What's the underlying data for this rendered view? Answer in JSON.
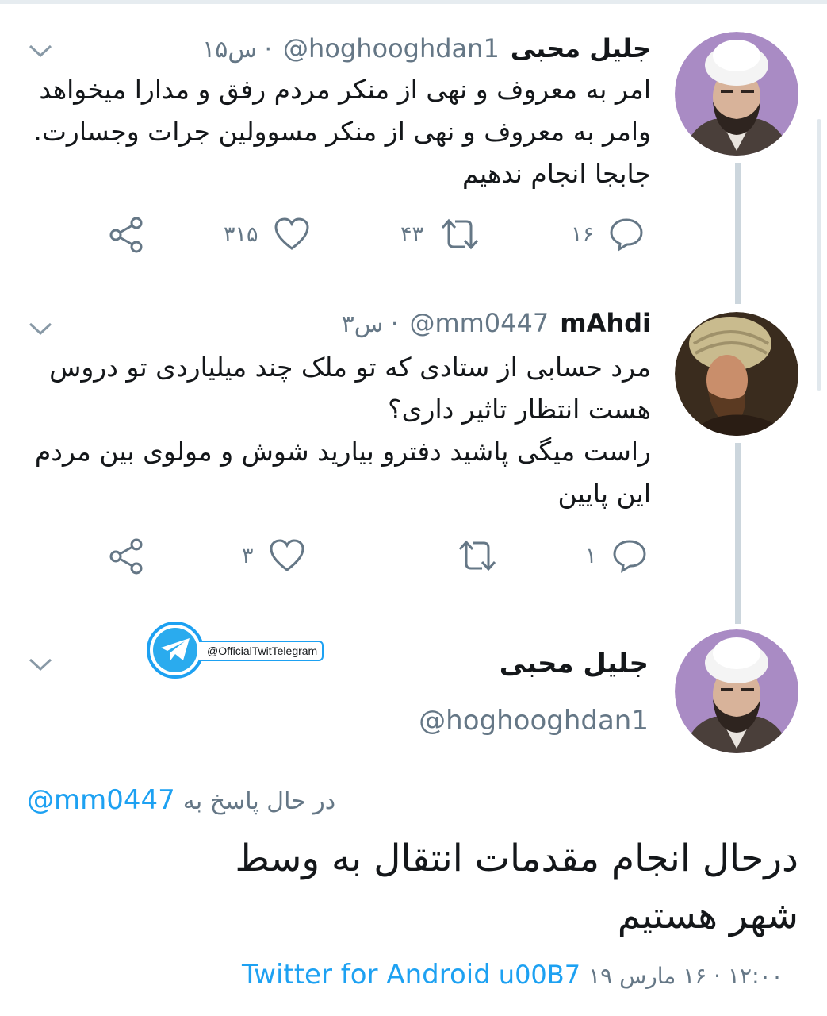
{
  "colors": {
    "accent": "#1da1f2",
    "muted": "#657786",
    "text": "#14171a",
    "thread_line": "#ccd6dd"
  },
  "tweets": [
    {
      "name": "جلیل محبی",
      "handle": "@hoghooghdan1",
      "time": "۱۵س · ",
      "lines": [
        "امر به معروف و نهی از منکر مردم رفق و مدارا میخواهد",
        "وامر به معروف و نهی از منکر مسوولین جرات وجسارت.",
        "جابجا انجام ندهیم"
      ],
      "actions": {
        "reply_count": "۱۶",
        "retweet_count": "۴۳",
        "like_count": "۳۱۵",
        "share_count": ""
      }
    },
    {
      "name": "mAhdi",
      "handle": "@mm0447",
      "time": "۳س · ",
      "lines": [
        "مرد حسابی از ستادی که تو ملک چند میلیاردی تو دروس",
        "هست انتظار تاثیر داری؟",
        "راست میگی پاشید دفترو بیارید شوش و مولوی بین مردم",
        "این پایین"
      ],
      "actions": {
        "reply_count": "۱",
        "retweet_count": "",
        "like_count": "۳",
        "share_count": ""
      }
    }
  ],
  "main_tweet": {
    "name": "جلیل محبی",
    "handle": "@hoghooghdan1",
    "reply_prefix": "در حال پاسخ به",
    "reply_to": "@mm0447",
    "lines": [
      "درحال انجام مقدمات انتقال به وسط",
      "شهر هستیم"
    ],
    "time": "۱۲:۰۰ · ۱۶ مارس ۱۹",
    "separator": "u00B7",
    "source": "Twitter for Android"
  },
  "watermark": {
    "text": "@OfficialTwitTelegram"
  }
}
